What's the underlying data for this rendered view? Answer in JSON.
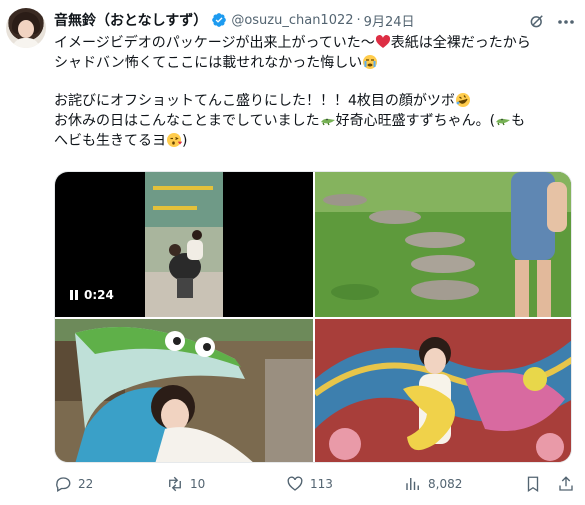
{
  "author": {
    "display_name": "音無鈴（おとなしすず）",
    "handle": "@osuzu_chan1022",
    "separator": "·",
    "date": "9月24日"
  },
  "tweet": {
    "line1": "イメージビデオのパッケージが出来上がっていた〜",
    "line1b": "表紙は全裸だったから",
    "line2": "シャドバン怖くてここには載せれなかった悔しい",
    "line3": "お詫びにオフショットてんこ盛りにした！！！4枚目の顔がツボ",
    "line4a": "お休みの日はこんなことまでしていました",
    "line4b": "好奇心旺盛すずちゃん。(",
    "line4c": "も",
    "line5": "へビも生きてるヨ",
    "line5b": ")"
  },
  "media": {
    "video_duration": "0:24"
  },
  "actions": {
    "replies": "22",
    "reposts": "10",
    "likes": "113",
    "views": "8,082"
  },
  "colors": {
    "text": "#0f1419",
    "secondary": "#536471",
    "verified": "#1d9bf0"
  }
}
